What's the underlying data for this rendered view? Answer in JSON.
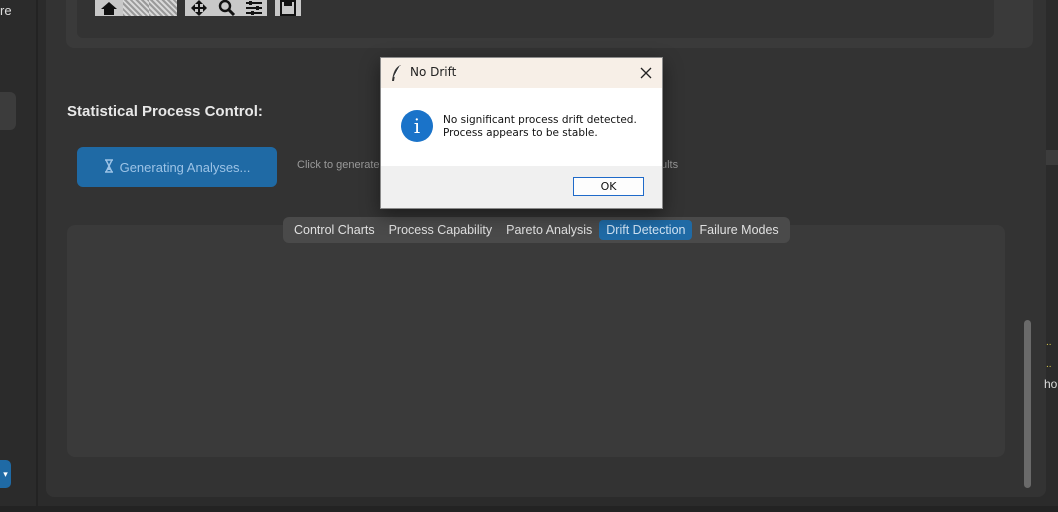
{
  "left_edge": {
    "partial_text": "re",
    "blue_btn_glyph": "▾"
  },
  "toolbar": {
    "icons": [
      "home-icon",
      "back-icon",
      "forward-icon",
      "pan-icon",
      "zoom-icon",
      "configure-icon",
      "save-icon"
    ]
  },
  "section": {
    "title": "Statistical Process Control:",
    "generate_button": {
      "icon": "hourglass-icon",
      "label": "Generating Analyses..."
    },
    "hint": "Click to generate",
    "hint_tail": "ults"
  },
  "tabs": [
    {
      "label": "Control Charts",
      "active": false
    },
    {
      "label": "Process Capability",
      "active": false
    },
    {
      "label": "Pareto Analysis",
      "active": false
    },
    {
      "label": "Drift Detection",
      "active": true
    },
    {
      "label": "Failure Modes",
      "active": false
    }
  ],
  "right_edge": {
    "dots1": "..",
    "dots2": "..",
    "partial_text": "ho"
  },
  "dialog": {
    "title": "No Drift",
    "icon": "info-icon",
    "message_line1": "No significant process drift detected.",
    "message_line2": "Process appears to be stable.",
    "ok_label": "OK"
  },
  "colors": {
    "accent": "#1f6aa5",
    "background": "#2b2b2b",
    "panel": "#333333",
    "dialog_title_bg": "#f7efe7",
    "info_blue": "#1a73c9"
  }
}
